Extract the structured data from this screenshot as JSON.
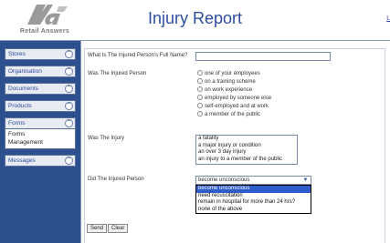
{
  "header": {
    "logo_text": "Retail Answers",
    "logo_mark": "ra",
    "title": "Injury Report",
    "logout_label": "Lo"
  },
  "sidebar": {
    "items": [
      {
        "label": "Stores",
        "toggle": "⌃"
      },
      {
        "label": "Organisation",
        "toggle": "⌃"
      },
      {
        "label": "Documents",
        "toggle": "⌃"
      },
      {
        "label": "Products",
        "toggle": "⌃"
      },
      {
        "label": "Forms",
        "toggle": "⌃",
        "sub": [
          "Forms",
          "Management"
        ]
      },
      {
        "label": "Messages",
        "toggle": "⌃"
      }
    ]
  },
  "form": {
    "full_name_label": "What Is The Injured Person's Full Name?",
    "full_name_value": "",
    "was_person_label": "Was The Injured Person",
    "person_options": [
      "one of your employees",
      "on a training scheme",
      "on work experience",
      "employed by someone else",
      "self-employed and at work",
      "a member of the public"
    ],
    "injury_label": "Was The Injury",
    "injury_options": [
      "a fatality",
      "a major injury or condition",
      "an over 3 day injury",
      "an injury to a member of the public"
    ],
    "did_person_label": "Did The Injured Person",
    "did_person_selected": "become unconscious",
    "did_person_options": [
      "become unconscious",
      "need recuscitation",
      "remain in hospital for more than 24 hrs?",
      "none of the above"
    ],
    "send_label": "Send",
    "clear_label": "Clear"
  },
  "colors": {
    "brand_blue": "#2e4d9e",
    "sidebar_bg": "#2c4f8d",
    "selected_option": "#2e5cc8"
  }
}
